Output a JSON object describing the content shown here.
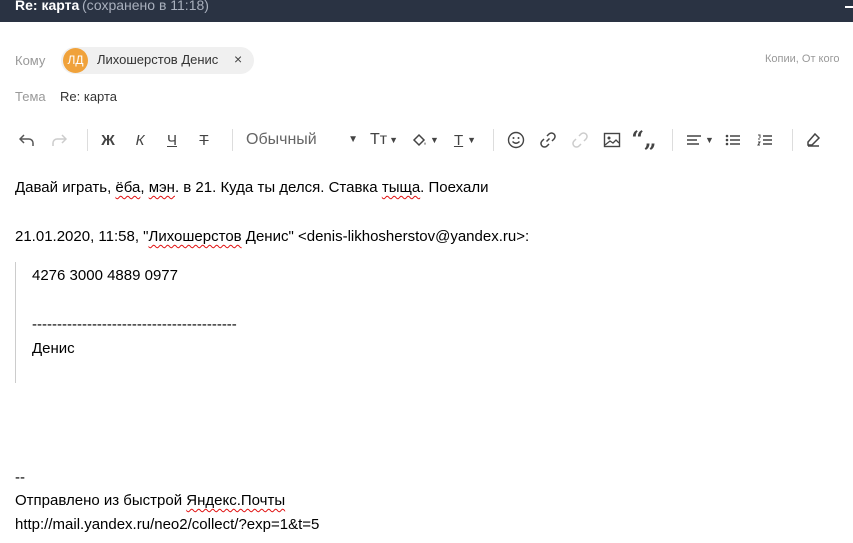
{
  "window": {
    "title": "Re: карта",
    "saved_status": "(сохранено в 11:18)"
  },
  "header": {
    "to_label": "Кому",
    "recipient": {
      "initials": "ЛД",
      "name": "Лихошерстов Денис",
      "remove_glyph": "×",
      "avatar_color": "#f0a23b"
    },
    "cc_link": "Копии, От кого",
    "subject_label": "Тема",
    "subject_value": "Re: карта"
  },
  "toolbar": {
    "bold": "Ж",
    "italic": "К",
    "underline": "Ч",
    "strike": "Т",
    "style_select": "Обычный",
    "font_size": "Тт",
    "text_color": "Т",
    "icons": [
      "undo-icon",
      "redo-icon",
      "bg-color-icon",
      "emoji-icon",
      "link-icon",
      "unlink-icon",
      "image-icon",
      "quote-icon",
      "align-icon",
      "bullet-list-icon",
      "numbered-list-icon",
      "clear-format-icon"
    ]
  },
  "body": {
    "line1": {
      "p1": "Давай играть, ",
      "w1": "ёба",
      "p2": ", ",
      "w2": "мэн",
      "p3": ". в 21. Куда ты делся. Ставка ",
      "w3": "тыща",
      "p4": ". Поехали"
    },
    "quote_header": {
      "p1": "21.01.2020, 11:58, \"",
      "name": "Лихошерстов",
      "p2": " Денис\" <denis-likhosherstov@yandex.ru>:"
    },
    "quote": {
      "card_number": "4276 3000 4889 0977",
      "divider": "-----------------------------------------",
      "signature": "Денис"
    },
    "footer": {
      "dashes": "--",
      "sent_from_prefix": "Отправлено из быстрой ",
      "sent_from_app": "Яндекс.Почты",
      "url": "http://mail.yandex.ru/neo2/collect/?exp=1&t=5"
    }
  }
}
